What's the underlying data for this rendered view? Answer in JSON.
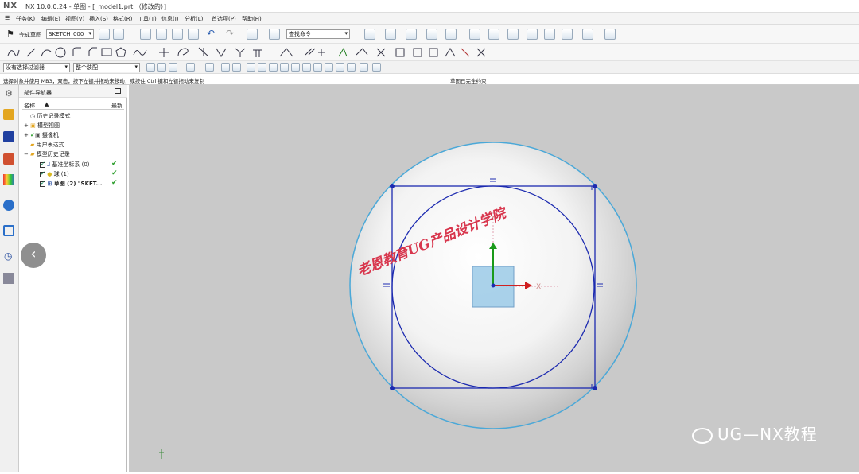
{
  "titlebar": {
    "logo": "NX",
    "title": "NX 10.0.0.24 - 单图 - [_model1.prt （修改的）]"
  },
  "menu": [
    "任务(K)",
    "编辑(E)",
    "视图(V)",
    "插入(S)",
    "格式(R)",
    "工具(T)",
    "信息(I)",
    "分析(L)",
    "首选项(P)",
    "帮助(H)"
  ],
  "toolbar": {
    "finish_sketch": "完成草图",
    "sketch_name": "SKETCH_000",
    "search_placeholder": "查找命令",
    "filter_select": "没有选择过滤器",
    "assembly_select": "整个装配"
  },
  "status": {
    "left": "选择对象并使用 MB3，双击，按下左键并拖动来移动，或按住 Ctrl 键和左键拖动来复制",
    "center": "草图已完全约束"
  },
  "navigator": {
    "title": "部件导航器",
    "col_name": "名称",
    "col_recent": "最新",
    "items": [
      {
        "label": "历史记录模式"
      },
      {
        "label": "模型视图"
      },
      {
        "label": "摄像机"
      },
      {
        "label": "用户表达式"
      },
      {
        "label": "模型历史记录"
      },
      {
        "label": "基准坐标系 (0)"
      },
      {
        "label": "球 (1)"
      },
      {
        "label": "草图 (2) \"SKET..."
      }
    ]
  },
  "canvas": {
    "watermark_red": "老恩教育UG产品设计学院",
    "watermark_bottom": "UG—NX教程",
    "axis_x": "X",
    "axis_y": "Y"
  },
  "colors": {
    "sketch_blue": "#1c2ab0",
    "sphere_edge": "#4aa8d8",
    "canvas_bg": "#c9c9c9"
  }
}
